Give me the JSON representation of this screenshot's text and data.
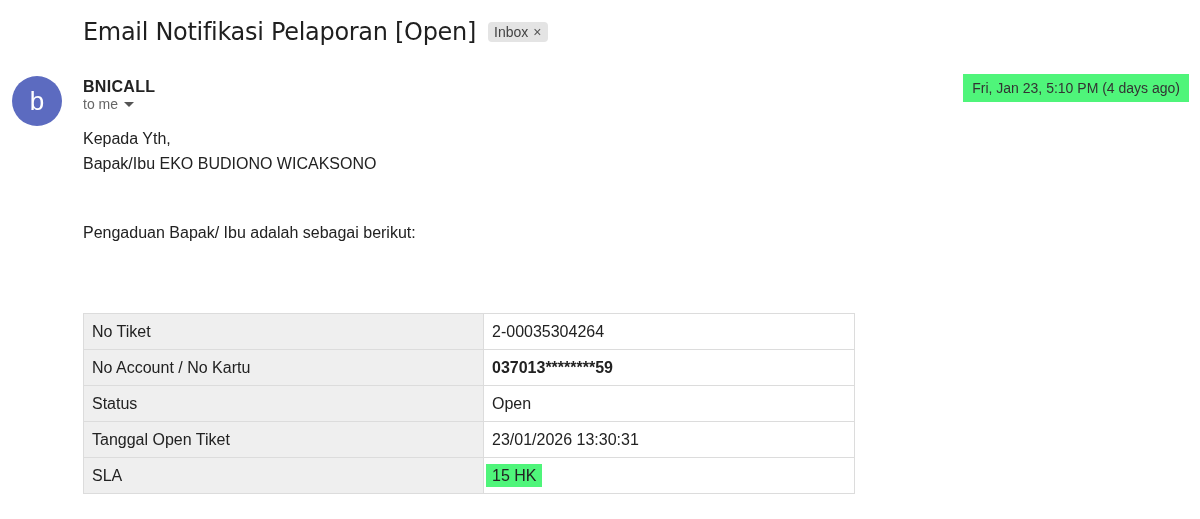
{
  "subject": {
    "title": "Email Notifikasi Pelaporan [Open]",
    "label": "Inbox",
    "label_remove": "×"
  },
  "message": {
    "avatar_letter": "b",
    "sender": "BNICALL",
    "recipient": "to me",
    "date": "Fri, Jan 23, 5:10 PM (4 days ago)",
    "date_highlighted": true
  },
  "body": {
    "greeting": [
      "Kepada Yth,",
      "Bapak/Ibu EKO BUDIONO WICAKSONO"
    ],
    "intro": "Pengaduan Bapak/ Ibu adalah sebagai berikut:"
  },
  "table": {
    "rows": [
      {
        "label": "No Tiket",
        "value": "2-00035304264",
        "bold": false,
        "highlighted": false
      },
      {
        "label": "No Account / No Kartu",
        "value": "037013********59",
        "bold": true,
        "highlighted": false
      },
      {
        "label": "Status",
        "value": "Open",
        "bold": false,
        "highlighted": false
      },
      {
        "label": "Tanggal Open Tiket",
        "value": "23/01/2026 13:30:31",
        "bold": false,
        "highlighted": false
      },
      {
        "label": "SLA",
        "value": "15 HK",
        "bold": false,
        "highlighted": true
      }
    ]
  }
}
